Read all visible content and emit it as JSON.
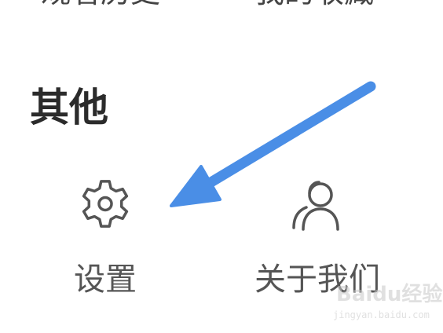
{
  "top_row": {
    "left_label": "观看历史",
    "right_label": "我的收藏"
  },
  "section": {
    "title": "其他"
  },
  "items": [
    {
      "label": "设置",
      "icon": "gear-icon"
    },
    {
      "label": "关于我们",
      "icon": "users-icon"
    }
  ],
  "annotation": {
    "arrow_color": "#4a8ee6",
    "target": "设置"
  },
  "watermark": {
    "logo": "Baidu经验",
    "url": "jingyan.baidu.com"
  },
  "colors": {
    "background": "#ffffff",
    "title": "#2b2b2b",
    "label": "#555555",
    "icon_stroke": "#555555"
  }
}
